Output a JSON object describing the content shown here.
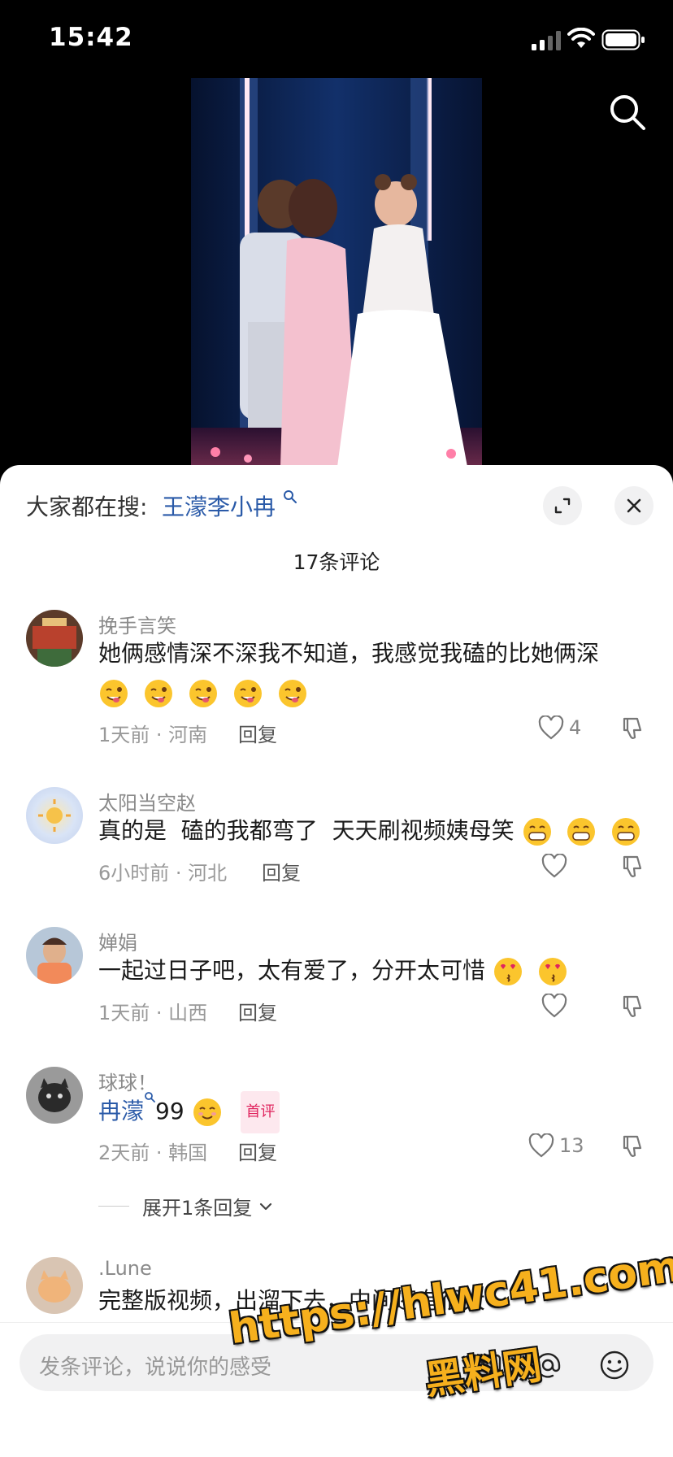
{
  "status_bar": {
    "time": "15:42"
  },
  "video": {
    "stage_colors": [
      "#0c1a3b",
      "#ffb6c9",
      "#ffffff"
    ]
  },
  "sheet": {
    "hot_search_prefix": "大家都在搜:",
    "hot_search_term": "王濛李小冉",
    "comment_count": "17条评论"
  },
  "comments": [
    {
      "username": "挽手言笑",
      "text": "她俩感情深不深我不知道，我感觉我磕的比她俩深",
      "emojis": [
        "wink-tongue-emoji",
        "wink-tongue-emoji",
        "wink-tongue-emoji",
        "wink-tongue-emoji",
        "wink-tongue-emoji"
      ],
      "meta": "1天前 · 河南",
      "reply_label": "回复",
      "likes": "4"
    },
    {
      "username": "太阳当空赵",
      "text": "真的是  磕的我都弯了  天天刷视频姨母笑",
      "emojis": [
        "grin-emoji",
        "grin-emoji",
        "grin-emoji"
      ],
      "meta": "6小时前 · 河北",
      "reply_label": "回复",
      "likes": ""
    },
    {
      "username": "婵娟",
      "text": "一起过日子吧，太有爱了，分开太可惜",
      "emojis": [
        "heart-eyes-kiss-emoji",
        "heart-eyes-kiss-emoji"
      ],
      "meta": "1天前 · 山西",
      "reply_label": "回复",
      "likes": ""
    },
    {
      "username": "球球！",
      "mention": "冉濛",
      "text": "99",
      "emojis": [
        "shy-smile-emoji"
      ],
      "badge": "首评",
      "meta": "2天前 · 韩国",
      "reply_label": "回复",
      "likes": "13",
      "expand_label": "展开1条回复"
    },
    {
      "username": ".Lune",
      "text": "完整版视频，出溜下去，中间还有很大"
    }
  ],
  "input_bar": {
    "placeholder": "发条评论，说说你的感受"
  },
  "watermark": {
    "url": "https://hlwc41.com",
    "name": "黑料网"
  }
}
